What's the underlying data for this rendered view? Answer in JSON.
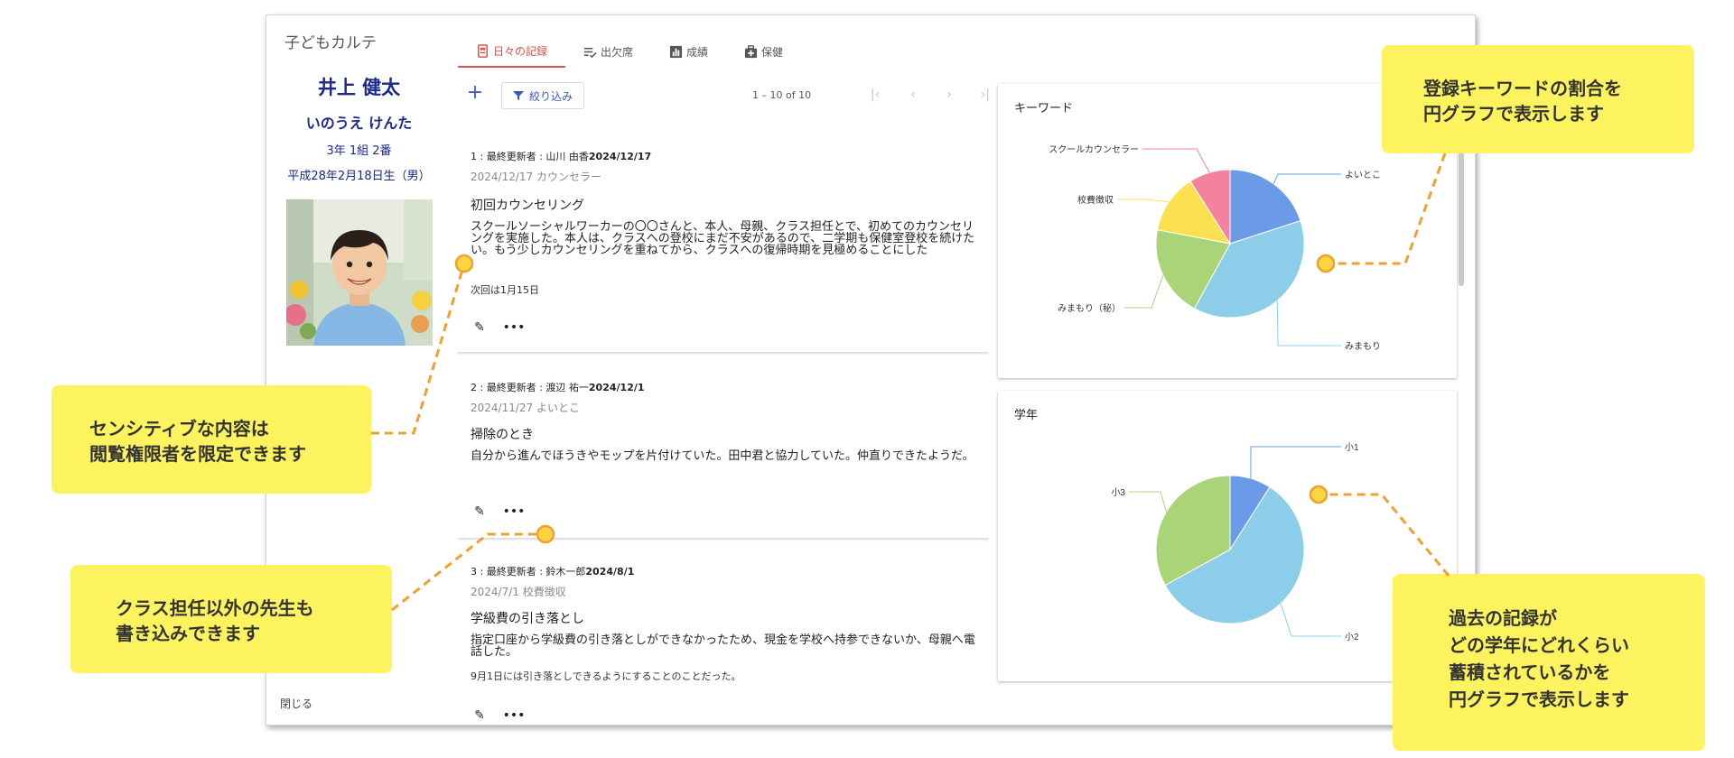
{
  "app": {
    "title": "子どもカルテ",
    "close_label": "閉じる"
  },
  "student": {
    "name_kanji": "井上 健太",
    "name_kana": "いのうえ けんた",
    "class_info": "3年 1組 2番",
    "birth_info": "平成28年2月18日生（男）"
  },
  "tabs": [
    {
      "label": "日々の記録",
      "icon": "notebook-icon",
      "active": true
    },
    {
      "label": "出欠席",
      "icon": "list-check-icon",
      "active": false
    },
    {
      "label": "成績",
      "icon": "bar-chart-icon",
      "active": false
    },
    {
      "label": "保健",
      "icon": "medical-kit-icon",
      "active": false
    }
  ],
  "toolbar": {
    "add_label": "+",
    "filter_label": "絞り込み",
    "pager_text": "1 – 10 of 10"
  },
  "records": [
    {
      "updater_prefix": "1 : 最終更新者 : 山川 由香",
      "updated_date": "2024/12/17",
      "meta": "2024/12/17 カウンセラー",
      "title": "初回カウンセリング",
      "body": "スクールソーシャルワーカーの〇〇さんと、本人、母親、クラス担任とで、初めてのカウンセリングを実施した。本人は、クラスへの登校にまだ不安があるので、二学期も保健室登校を続けたい。もう少しカウンセリングを重ねてから、クラスへの復帰時期を見極めることにした",
      "note": "次回は1月15日"
    },
    {
      "updater_prefix": "2 : 最終更新者 : 渡辺 祐一",
      "updated_date": "2024/12/1",
      "meta": "2024/11/27 よいとこ",
      "title": "掃除のとき",
      "body": "自分から進んでほうきやモップを片付けていた。田中君と協力していた。仲直りできたようだ。",
      "note": ""
    },
    {
      "updater_prefix": "3 : 最終更新者 : 鈴木一郎",
      "updated_date": "2024/8/1",
      "meta": "2024/7/1 校費徴収",
      "title": "学級費の引き落とし",
      "body": "指定口座から学級費の引き落としができなかったため、現金を学校へ持参できないか、母親へ電話した。",
      "note": "9月1日には引き落としできるようにすることのことだった。"
    }
  ],
  "charts": {
    "keyword": {
      "title": "キーワード",
      "chart_data": {
        "type": "pie",
        "categories": [
          "よいとこ",
          "みまもり",
          "みまもり（秘）",
          "校費徴収",
          "スクールカウンセラー"
        ],
        "values": [
          20,
          38,
          20,
          13,
          9
        ],
        "colors": [
          "#6b9be8",
          "#8ccdea",
          "#a9d477",
          "#fbe04f",
          "#f4829f"
        ]
      }
    },
    "grade": {
      "title": "学年",
      "chart_data": {
        "type": "pie",
        "categories": [
          "小1",
          "小2",
          "小3"
        ],
        "values": [
          9,
          58,
          33
        ],
        "colors": [
          "#6b9be8",
          "#8ccdea",
          "#a9d477"
        ]
      }
    }
  },
  "callouts": {
    "keyword_pie": [
      "登録キーワードの割合を",
      "円グラフで表示します"
    ],
    "sensitive": [
      "センシティブな内容は",
      "閲覧権限者を限定できます"
    ],
    "other_teachers": [
      "クラス担任以外の先生も",
      "書き込みできます"
    ],
    "grade_pie": [
      "過去の記録が",
      "どの学年にどれくらい",
      "蓄積されているかを",
      "円グラフで表示します"
    ]
  },
  "colors": {
    "accent": "#d9534f",
    "callout": "#fdf35e",
    "name": "#1a2a8c",
    "leader": "#f0a030"
  }
}
